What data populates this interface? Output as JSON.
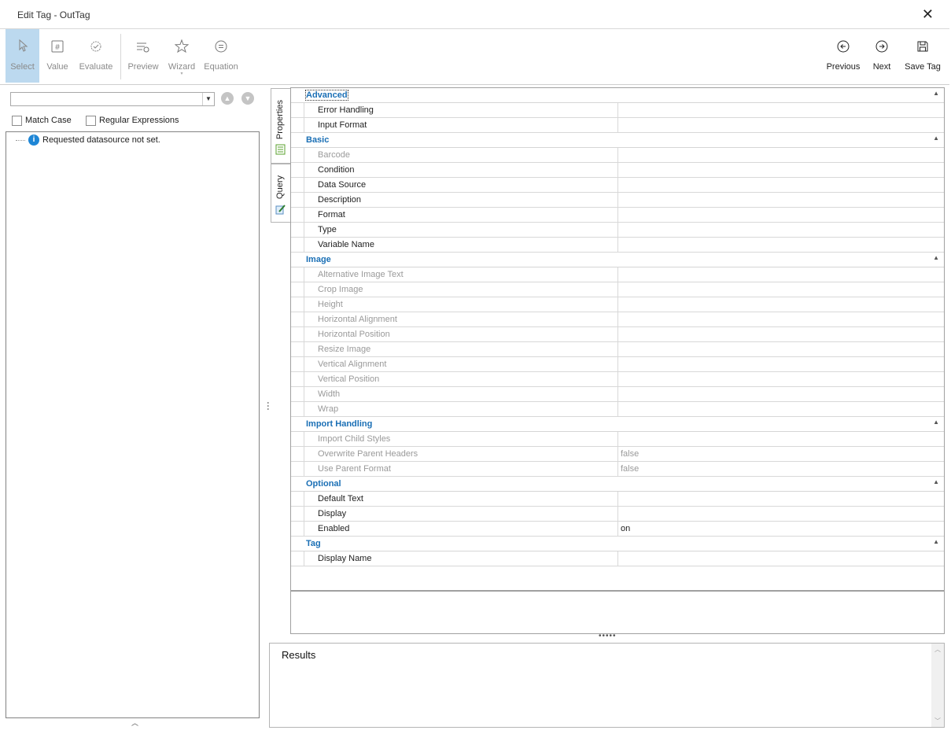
{
  "window": {
    "title": "Edit Tag - OutTag",
    "close": "✕"
  },
  "ribbon": {
    "select": "Select",
    "value": "Value",
    "evaluate": "Evaluate",
    "preview": "Preview",
    "wizard": "Wizard",
    "equation": "Equation",
    "previous": "Previous",
    "next": "Next",
    "save_tag": "Save Tag"
  },
  "left": {
    "combo_value": "",
    "match_case": "Match Case",
    "regex": "Regular Expressions",
    "tree_message": "Requested datasource not set."
  },
  "tabs": {
    "properties": "Properties",
    "query": "Query"
  },
  "grid": {
    "categories": [
      {
        "name": "Advanced",
        "rows": [
          {
            "name": "Error Handling",
            "value": "",
            "enabled": true
          },
          {
            "name": "Input Format",
            "value": "",
            "enabled": true
          }
        ]
      },
      {
        "name": "Basic",
        "rows": [
          {
            "name": "Barcode",
            "value": "",
            "enabled": false
          },
          {
            "name": "Condition",
            "value": "",
            "enabled": true
          },
          {
            "name": "Data Source",
            "value": "",
            "enabled": true
          },
          {
            "name": "Description",
            "value": "",
            "enabled": true
          },
          {
            "name": "Format",
            "value": "",
            "enabled": true
          },
          {
            "name": "Type",
            "value": "",
            "enabled": true
          },
          {
            "name": "Variable Name",
            "value": "",
            "enabled": true
          }
        ]
      },
      {
        "name": "Image",
        "rows": [
          {
            "name": "Alternative Image Text",
            "value": "",
            "enabled": false
          },
          {
            "name": "Crop Image",
            "value": "",
            "enabled": false
          },
          {
            "name": "Height",
            "value": "",
            "enabled": false
          },
          {
            "name": "Horizontal Alignment",
            "value": "",
            "enabled": false
          },
          {
            "name": "Horizontal Position",
            "value": "",
            "enabled": false
          },
          {
            "name": "Resize Image",
            "value": "",
            "enabled": false
          },
          {
            "name": "Vertical Alignment",
            "value": "",
            "enabled": false
          },
          {
            "name": "Vertical Position",
            "value": "",
            "enabled": false
          },
          {
            "name": "Width",
            "value": "",
            "enabled": false
          },
          {
            "name": "Wrap",
            "value": "",
            "enabled": false
          }
        ]
      },
      {
        "name": "Import Handling",
        "rows": [
          {
            "name": "Import Child Styles",
            "value": "",
            "enabled": false
          },
          {
            "name": "Overwrite Parent Headers",
            "value": "false",
            "enabled": false
          },
          {
            "name": "Use Parent Format",
            "value": "false",
            "enabled": false
          }
        ]
      },
      {
        "name": "Optional",
        "rows": [
          {
            "name": "Default Text",
            "value": "",
            "enabled": true
          },
          {
            "name": "Display",
            "value": "",
            "enabled": true
          },
          {
            "name": "Enabled",
            "value": "on",
            "enabled": true
          }
        ]
      },
      {
        "name": "Tag",
        "rows": [
          {
            "name": "Display Name",
            "value": "",
            "enabled": true
          }
        ]
      }
    ]
  },
  "results": {
    "title": "Results"
  }
}
